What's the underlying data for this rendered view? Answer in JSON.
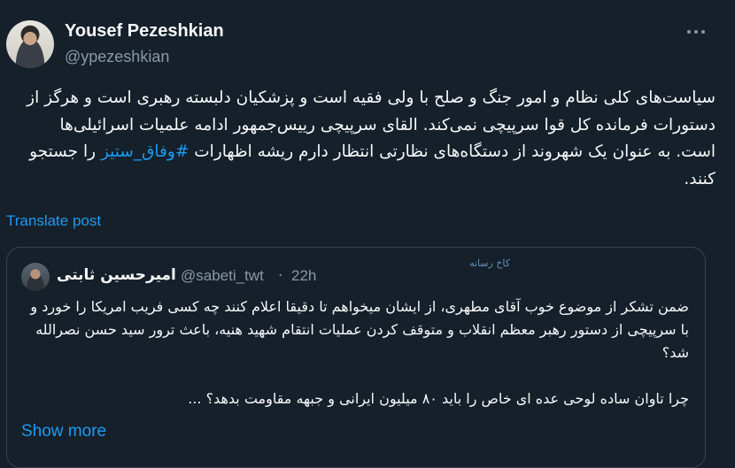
{
  "author": {
    "display_name": "Yousef Pezeshkian",
    "handle": "@ypezeshkian"
  },
  "tweet": {
    "text_before_hashtag": "سیاست‌های کلی نظام و امور جنگ و صلح با ولی فقیه است و پزشکیان دلبسته رهبری است و هرگز از دستورات فرمانده کل قوا سرپیچی نمی‌کند. القای سرپیچی رییس‌جمهور ادامه علمیات اسرائیلی‌ها است. به عنوان یک شهروند از دستگاه‌های نظارتی انتظار دارم ریشه اظهارات ",
    "hashtag": "#وفاق_ستیز",
    "text_after_hashtag": " را جستجو کنند.",
    "translate_label": "Translate post"
  },
  "quote": {
    "display_name": "امیرحسین ثابتی",
    "handle": "@sabeti_twt",
    "separator": "·",
    "time": "22h",
    "watermark": "کاخ رسانه",
    "paragraph_1": "ضمن تشکر از موضوع خوب آقای مطهری، از ایشان میخواهم تا دقیقا اعلام کنند چه کسی فریب امریکا را خورد و با سرپیچی از دستور رهبر معظم انقلاب و متوقف کردن عملیات انتقام شهید هنیه، باعث ترور سید حسن نصرالله شد؟",
    "paragraph_2": "چرا تاوان ساده لوحی عده ای خاص را باید ۸۰ میلیون ایرانی و جبهه مقاومت بدهد؟ ...",
    "show_more_label": "Show more"
  },
  "colors": {
    "background": "#15202b",
    "text": "#f7f9f9",
    "secondary": "#8b98a5",
    "accent": "#1d9bf0",
    "border": "#38444d"
  },
  "icons": {
    "more": "more-horizontal-icon"
  }
}
